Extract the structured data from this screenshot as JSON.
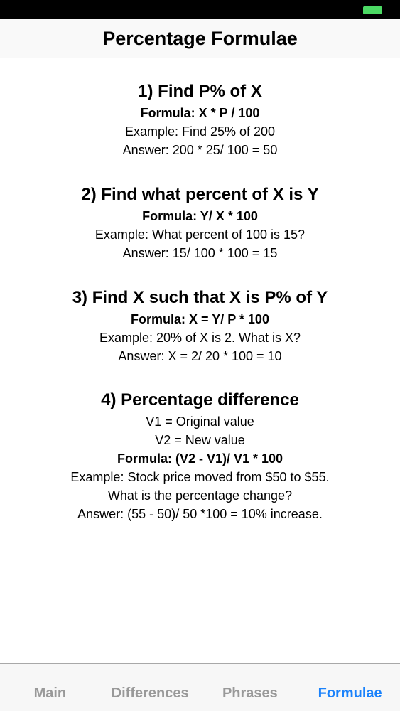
{
  "colors": {
    "accent": "#1a82fb",
    "inactive_tab": "#999999",
    "battery": "#4cd964"
  },
  "nav": {
    "title": "Percentage Formulae"
  },
  "sections": [
    {
      "heading": "1) Find P% of X",
      "formula": "Formula: X * P / 100",
      "lines": [
        "Example: Find 25% of 200",
        "Answer: 200 * 25/ 100 = 50"
      ]
    },
    {
      "heading": "2) Find what percent of X is Y",
      "formula": "Formula: Y/ X * 100",
      "lines": [
        "Example: What percent of 100 is 15?",
        "Answer: 15/ 100 * 100 = 15"
      ]
    },
    {
      "heading": "3) Find X such that X is P% of Y",
      "formula": "Formula: X = Y/ P * 100",
      "lines": [
        "Example: 20% of X is 2. What is X?",
        "Answer: X = 2/ 20 * 100 = 10"
      ]
    },
    {
      "heading": "4) Percentage difference",
      "pre_lines": [
        "V1 = Original value",
        "V2 = New value"
      ],
      "formula": "Formula: (V2 - V1)/ V1 * 100",
      "lines": [
        "Example: Stock price moved from $50 to $55.",
        "What is the percentage change?",
        "Answer: (55 - 50)/ 50 *100 = 10% increase."
      ]
    }
  ],
  "tabs": [
    {
      "label": "Main",
      "active": false
    },
    {
      "label": "Differences",
      "active": false
    },
    {
      "label": "Phrases",
      "active": false
    },
    {
      "label": "Formulae",
      "active": true
    }
  ]
}
